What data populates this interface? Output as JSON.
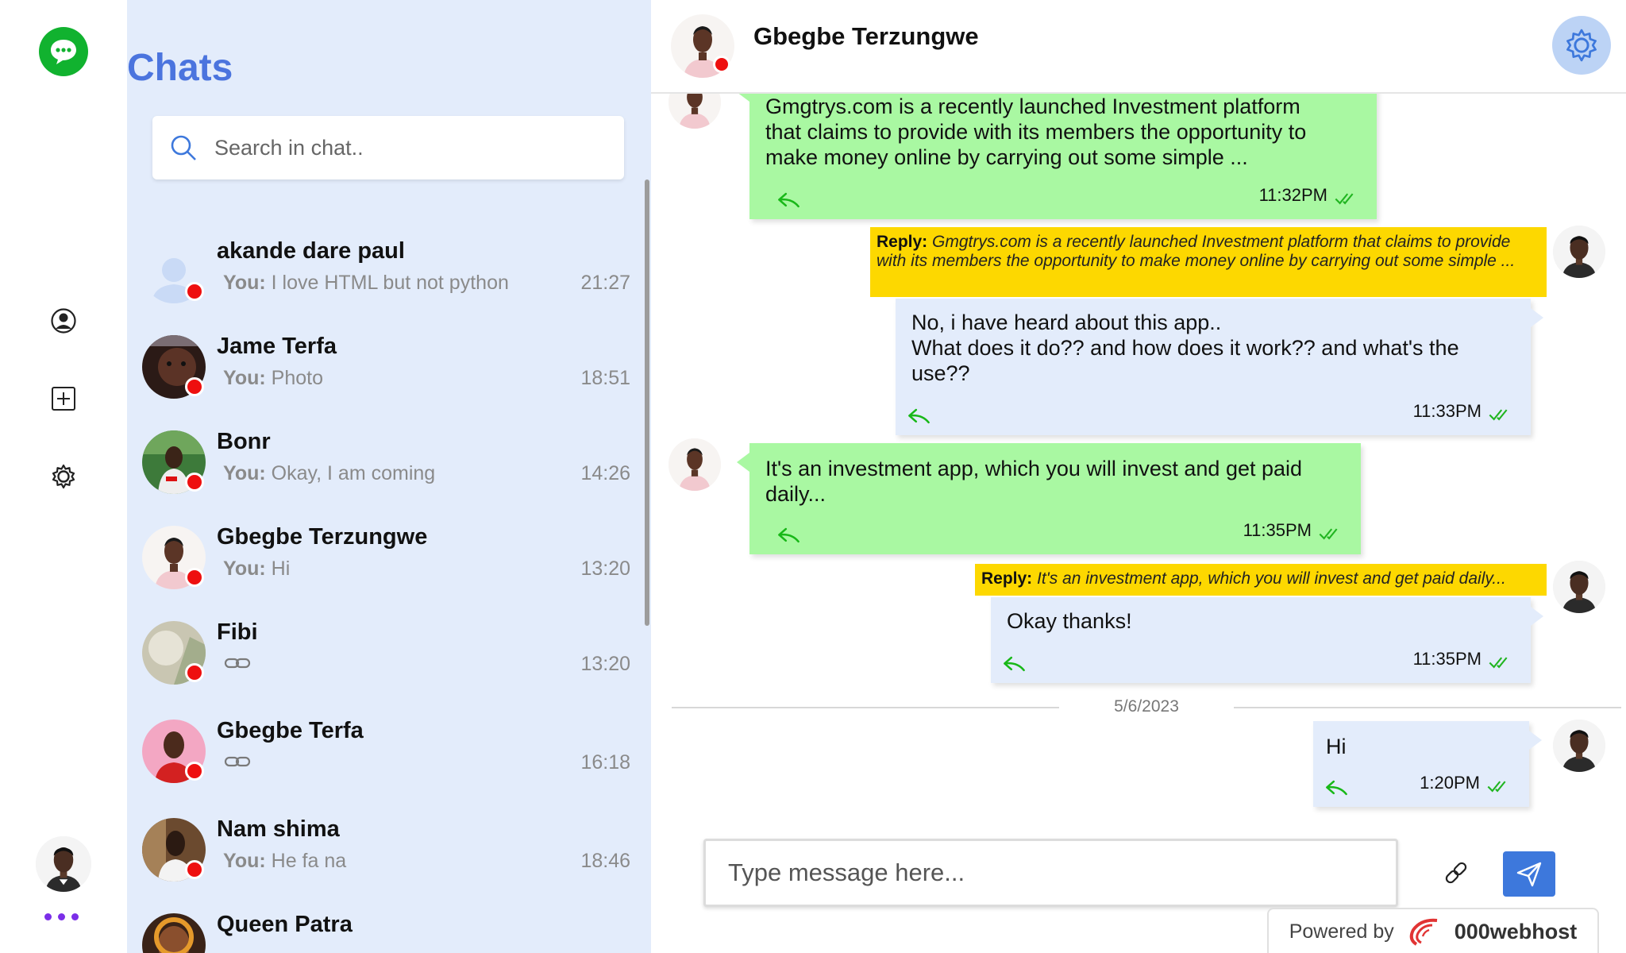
{
  "sidebar": {
    "nav_icons": [
      "chat-icon",
      "user-icon",
      "add-icon",
      "gear-icon",
      "more-icon"
    ]
  },
  "chat_list": {
    "title": "Chats",
    "search_placeholder": "Search in chat..",
    "items": [
      {
        "name": "akande dare paul",
        "prefix": "You:",
        "preview": "I love HTML but not python",
        "time": "21:27",
        "online_color": "#ee0f0f"
      },
      {
        "name": "Jame Terfa",
        "prefix": "You:",
        "preview": "Photo",
        "time": "18:51"
      },
      {
        "name": "Bonr",
        "prefix": "You:",
        "preview": "Okay, I am coming",
        "time": "14:26"
      },
      {
        "name": "Gbegbe Terzungwe",
        "prefix": "You:",
        "preview": "Hi",
        "time": "13:20"
      },
      {
        "name": "Fibi",
        "prefix": "",
        "preview": "",
        "preview_icon": "link-icon",
        "time": "13:20"
      },
      {
        "name": "Gbegbe Terfa",
        "prefix": "",
        "preview": "",
        "preview_icon": "link-icon",
        "time": "16:18"
      },
      {
        "name": "Nam shima",
        "prefix": "You:",
        "preview": "He fa na",
        "time": "18:46"
      },
      {
        "name": "Queen Patra",
        "prefix": "",
        "preview": "",
        "time": ""
      }
    ]
  },
  "conversation": {
    "contact_name": "Gbegbe Terzungwe",
    "messages": [
      {
        "side": "left",
        "text": "Gmgtrys.com is a recently launched Investment platform\nthat claims to provide with its members the opportunity to\nmake money online by carrying out some simple ...",
        "time": "11:32PM"
      },
      {
        "side": "right",
        "reply_label": "Reply:",
        "reply_text": "Gmgtrys.com is a recently launched Investment platform that claims to provide with its members the opportunity to make money online by carrying out some simple ...",
        "text": "No, i have heard about this app..\nWhat does it do?? and how does it work?? and what's the\nuse??",
        "time": "11:33PM"
      },
      {
        "side": "left",
        "text": "It's an investment app, which you will invest and get paid\ndaily...",
        "time": "11:35PM"
      },
      {
        "side": "right",
        "reply_label": "Reply:",
        "reply_text": "It's an investment app, which you will invest and get paid daily...",
        "text": "Okay thanks!",
        "time": "11:35PM"
      },
      {
        "side": "right",
        "text": "Hi",
        "time": "1:20PM"
      }
    ],
    "date_separator": "5/6/2023",
    "composer_placeholder": "Type message here..."
  },
  "footer": {
    "powered_by": "Powered by",
    "brand": "000webhost"
  },
  "colors": {
    "accent": "#4b74de",
    "list_bg": "#e3ecfb",
    "incoming_bubble": "#a9f8a2",
    "outgoing_bubble": "#e3ecfb",
    "reply_quote": "#fdd800",
    "status_dot": "#ee0f0f",
    "read_tick": "#21b521",
    "send_button": "#3d78dc"
  }
}
